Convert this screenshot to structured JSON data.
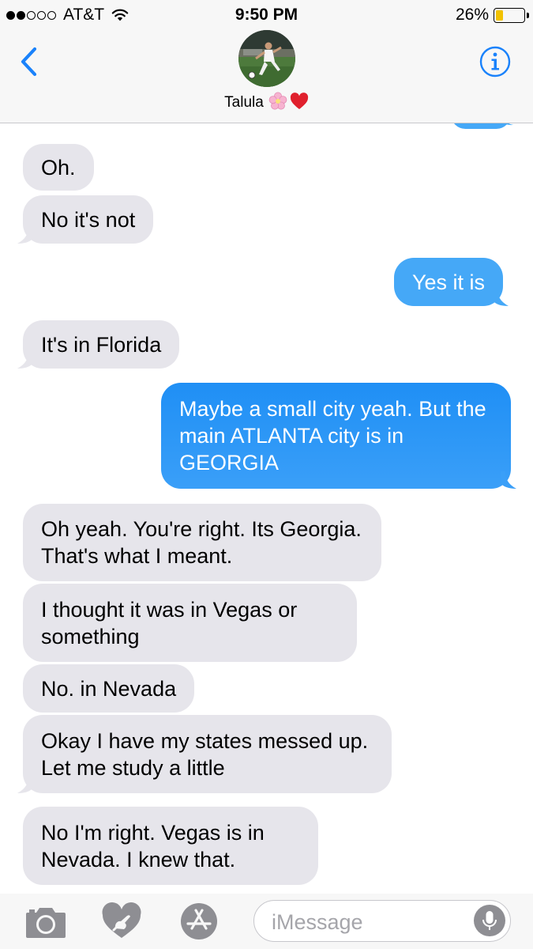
{
  "status_bar": {
    "carrier": "AT&T",
    "time": "9:50 PM",
    "battery_percent_label": "26%",
    "battery_level": 0.26,
    "signal_bars_filled": 2,
    "signal_bars_total": 5
  },
  "header": {
    "contact_name": "Talula",
    "name_emojis": [
      "cherry-blossom",
      "red-heart"
    ]
  },
  "messages": [
    {
      "direction": "received",
      "text": "Oh."
    },
    {
      "direction": "received",
      "text": "No it's not"
    },
    {
      "direction": "sent",
      "text": "Yes it is"
    },
    {
      "direction": "received",
      "text": "It's in Florida"
    },
    {
      "direction": "sent",
      "text": "Maybe a small city yeah. But the main ATLANTA city is in GEORGIA"
    },
    {
      "direction": "received",
      "text": "Oh yeah. You're right. Its Georgia. That's what I meant."
    },
    {
      "direction": "received",
      "text": "I thought it was in Vegas or something"
    },
    {
      "direction": "received",
      "text": "No. in Nevada"
    },
    {
      "direction": "received",
      "text": "Okay I have my states messed up. Let me study a little"
    },
    {
      "direction": "received",
      "text": "No I'm right. Vegas is in Nevada. I knew that."
    }
  ],
  "input_bar": {
    "placeholder": "iMessage",
    "icons": [
      "camera-icon",
      "digital-touch-icon",
      "app-store-icon",
      "microphone-icon"
    ]
  },
  "colors": {
    "sent_bubble": "#1f8ff5",
    "sent_bubble_light": "#45a8f7",
    "received_bubble": "#e6e5eb",
    "ios_blue": "#1a82fb",
    "battery_fill": "#f2c200"
  }
}
